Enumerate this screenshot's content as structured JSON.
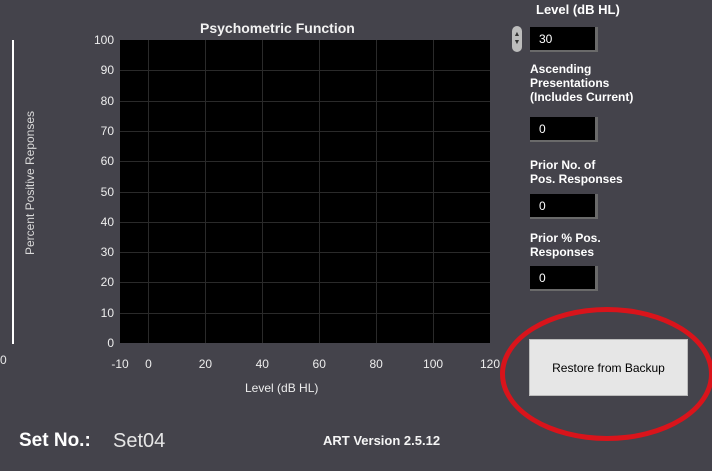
{
  "colors": {
    "background": "#44434b",
    "plot_background": "#000000",
    "button": "#e6e6e6",
    "annotation_ring": "#d9141b"
  },
  "left_edge_tick": "0",
  "chart_data": {
    "type": "line",
    "title": "Psychometric Function",
    "xlabel": "Level (dB HL)",
    "ylabel": "Percent  Positive Reponses",
    "xlim": [
      -10,
      120
    ],
    "ylim": [
      0,
      100
    ],
    "x_ticks": [
      "-10",
      "0",
      "20",
      "40",
      "60",
      "80",
      "100",
      "120"
    ],
    "y_ticks": [
      "0",
      "10",
      "20",
      "30",
      "40",
      "50",
      "60",
      "70",
      "80",
      "90",
      "100"
    ],
    "grid": true,
    "series": []
  },
  "controls": {
    "level_label": "Level (dB HL)",
    "level_value": "30",
    "ascending_label": "Ascending\nPresentations\n(Includes Current)",
    "ascending_value": "0",
    "prior_pos_label": "Prior No. of\nPos. Responses",
    "prior_pos_value": "0",
    "prior_pct_label": "Prior % Pos.\nResponses",
    "prior_pct_value": "0"
  },
  "restore_button": "Restore from Backup",
  "footer": {
    "set_label": "Set No.:",
    "set_value": "Set04",
    "version": "ART Version 2.5.12"
  }
}
